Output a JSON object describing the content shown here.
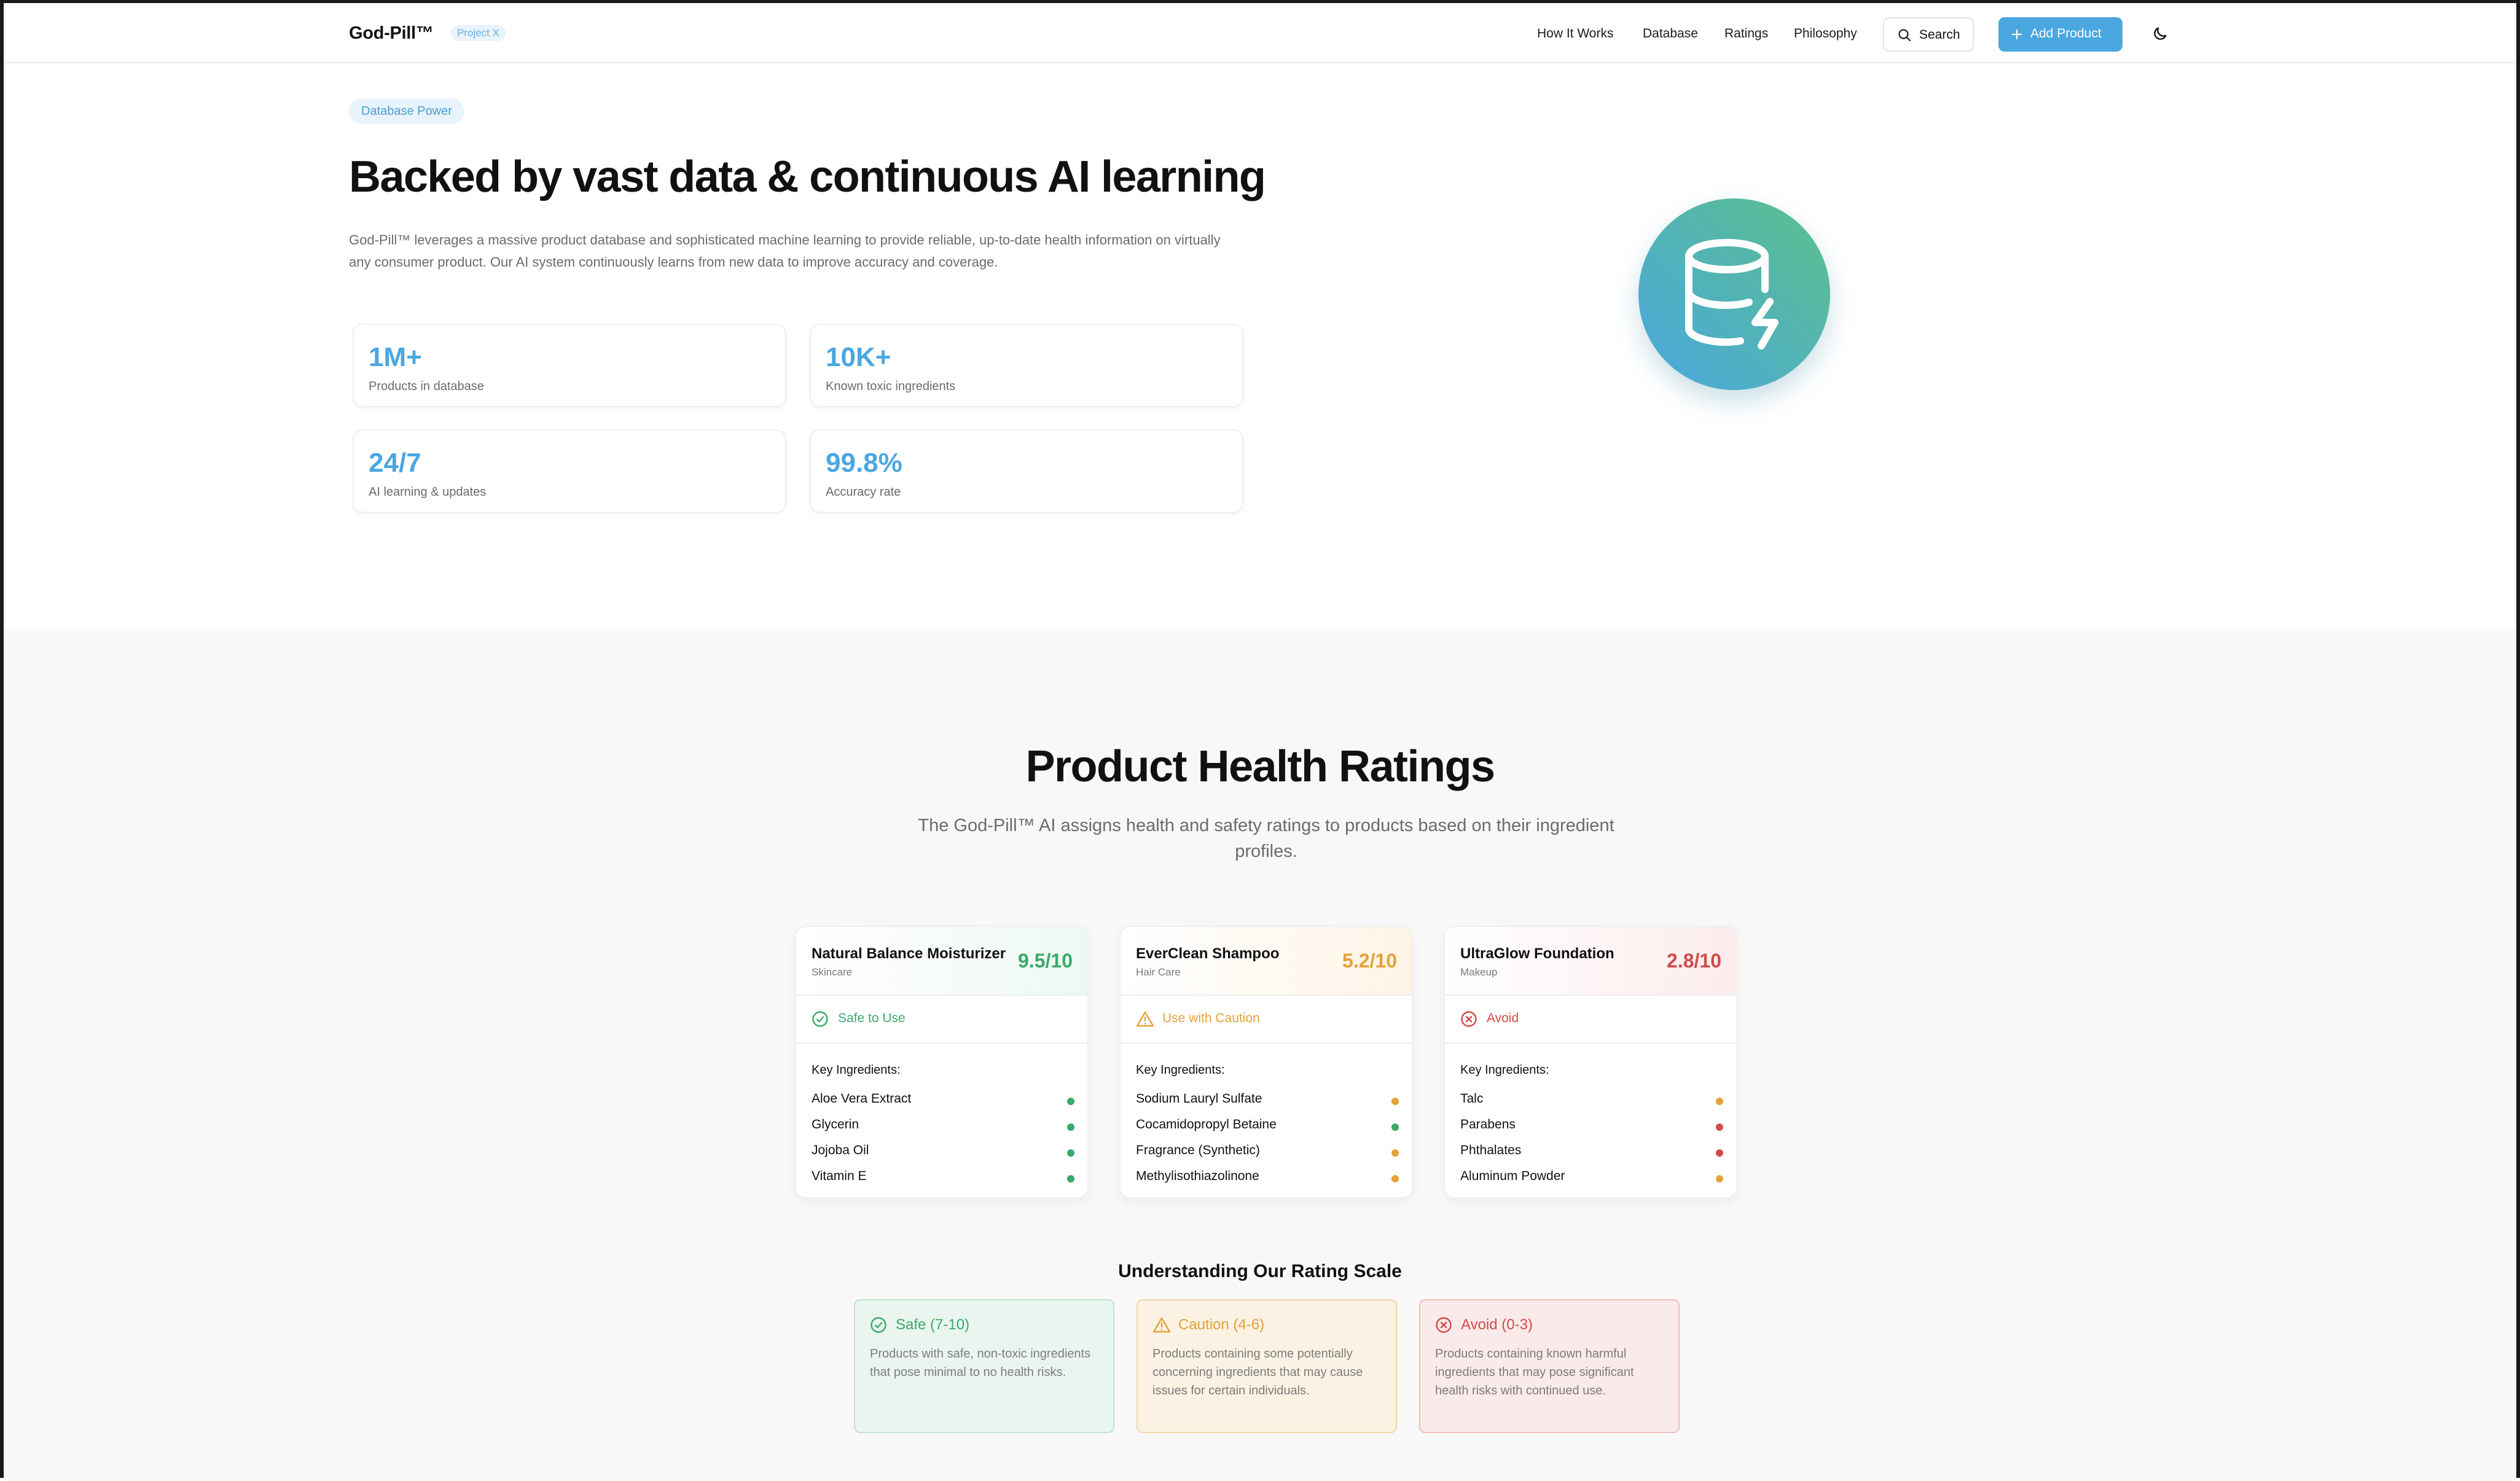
{
  "nav": {
    "brand": "God-Pill™",
    "badge": "Project X",
    "links": [
      "How It Works",
      "Database",
      "Ratings",
      "Philosophy"
    ],
    "search_label": "Search",
    "add_label": "Add Product"
  },
  "hero": {
    "pill": "Database Power",
    "title": "Backed by vast data & continuous AI learning",
    "description": "God-Pill™ leverages a massive product database and sophisticated machine learning to provide reliable, up-to-date health information on virtually any consumer product. Our AI system continuously learns from new data to improve accuracy and coverage.",
    "stats": [
      {
        "value": "1M+",
        "label": "Products in database"
      },
      {
        "value": "10K+",
        "label": "Known toxic ingredients"
      },
      {
        "value": "24/7",
        "label": "AI learning & updates"
      },
      {
        "value": "99.8%",
        "label": "Accuracy rate"
      }
    ]
  },
  "ratings": {
    "title": "Product Health Ratings",
    "subtitle": "The God-Pill™ AI assigns health and safety ratings to products based on their ingredient profiles.",
    "key_ingredients_label": "Key Ingredients:",
    "cards": [
      {
        "name": "Natural Balance Moisturizer",
        "category": "Skincare",
        "score": "9.5/10",
        "status": "Safe to Use",
        "status_icon": "check-circle-icon",
        "ingredients": [
          {
            "name": "Aloe Vera Extract",
            "level": "safe"
          },
          {
            "name": "Glycerin",
            "level": "safe"
          },
          {
            "name": "Jojoba Oil",
            "level": "safe"
          },
          {
            "name": "Vitamin E",
            "level": "safe"
          }
        ]
      },
      {
        "name": "EverClean Shampoo",
        "category": "Hair Care",
        "score": "5.2/10",
        "status": "Use with Caution",
        "status_icon": "warning-triangle-icon",
        "ingredients": [
          {
            "name": "Sodium Lauryl Sulfate",
            "level": "caution"
          },
          {
            "name": "Cocamidopropyl Betaine",
            "level": "safe"
          },
          {
            "name": "Fragrance (Synthetic)",
            "level": "caution"
          },
          {
            "name": "Methylisothiazolinone",
            "level": "caution"
          }
        ]
      },
      {
        "name": "UltraGlow Foundation",
        "category": "Makeup",
        "score": "2.8/10",
        "status": "Avoid",
        "status_icon": "x-circle-icon",
        "ingredients": [
          {
            "name": "Talc",
            "level": "caution"
          },
          {
            "name": "Parabens",
            "level": "avoid"
          },
          {
            "name": "Phthalates",
            "level": "avoid"
          },
          {
            "name": "Aluminum Powder",
            "level": "caution"
          }
        ]
      }
    ],
    "scale_title": "Understanding Our Rating Scale",
    "scale": [
      {
        "label": "Safe (7-10)",
        "description": "Products with safe, non-toxic ingredients that pose minimal to no health risks."
      },
      {
        "label": "Caution (4-6)",
        "description": "Products containing some potentially concerning ingredients that may cause issues for certain individuals."
      },
      {
        "label": "Avoid (0-3)",
        "description": "Products containing known harmful ingredients that may pose significant health risks with continued use."
      }
    ]
  },
  "colors": {
    "accent": "#4aa7e0",
    "safe": "#3aa96a",
    "caution": "#e3a23a",
    "avoid": "#d24b4b"
  }
}
